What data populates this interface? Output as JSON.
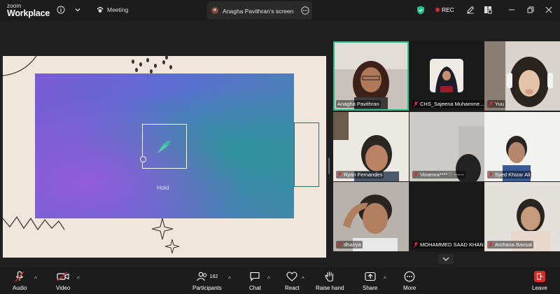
{
  "app": {
    "logo_small": "zoom",
    "logo_big": "Workplace"
  },
  "topbar": {
    "meeting_label": "Meeting",
    "share_tab_label": "Anagha Pavithran's screen",
    "rec_label": "REC"
  },
  "slide": {
    "hold_label": "Hold"
  },
  "participants": [
    {
      "name": "Anagha Pavithran",
      "muted": false,
      "active": true
    },
    {
      "name": "CHS_Sajeena Muhamme...",
      "muted": true
    },
    {
      "name": "Yuu",
      "muted": true
    },
    {
      "name": "Ryan Fernandes",
      "muted": true
    },
    {
      "name": "Vinamra****♡ ------",
      "muted": true
    },
    {
      "name": "Syed Khizar Ali",
      "muted": true
    },
    {
      "name": "dhairya",
      "muted": true
    },
    {
      "name": "MOHAMMED SAAD KHAN",
      "muted": true
    },
    {
      "name": "Archana Bansal",
      "muted": true
    }
  ],
  "toolbar": {
    "audio": "Audio",
    "video": "Video",
    "participants": "Participants",
    "participants_count": "162",
    "chat": "Chat",
    "react": "React",
    "raise_hand": "Raise hand",
    "share": "Share",
    "more": "More",
    "leave": "Leave"
  },
  "colors": {
    "accent_green": "#27c28a",
    "rec_red": "#e02828",
    "leave_red": "#e02828"
  }
}
